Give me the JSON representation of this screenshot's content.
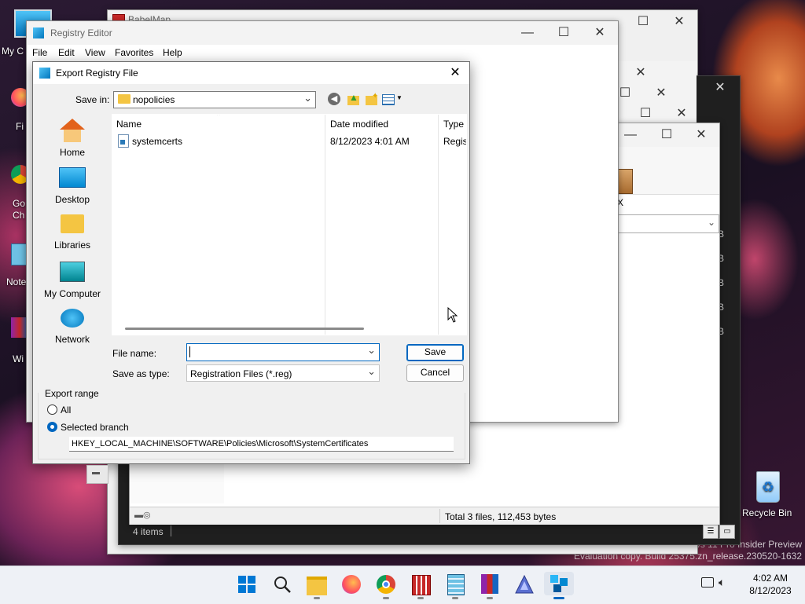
{
  "desktop": {
    "icons": [
      {
        "label": "My C"
      },
      {
        "label": "Fi"
      },
      {
        "label": "Go Ch"
      },
      {
        "label": "Note"
      },
      {
        "label": "Wi"
      },
      {
        "label": "Recycle Bin"
      }
    ],
    "watermark_line1": "ws 11 Pro Insider Preview",
    "watermark_line2": "Evaluation copy. Build 25375.zn_release.230520-1632"
  },
  "bg_windows": {
    "babelmap_title": "BabelMap",
    "file_manager": {
      "status_total": "Total 3 files, 112,453 bytes",
      "items_count": "4 items",
      "right_letters": [
        "B",
        "B",
        "B",
        "B",
        "B"
      ],
      "partial_icon_label": "X"
    }
  },
  "registry_editor": {
    "title": "Registry Editor",
    "menu": [
      "File",
      "Edit",
      "View",
      "Favorites",
      "Help"
    ]
  },
  "dialog": {
    "title": "Export Registry File",
    "save_in_label": "Save in:",
    "save_in_value": "nopolicies",
    "places": [
      "Home",
      "Desktop",
      "Libraries",
      "My Computer",
      "Network"
    ],
    "columns": [
      "Name",
      "Date modified",
      "Type"
    ],
    "files": [
      {
        "name": "systemcerts",
        "date": "8/12/2023 4:01 AM",
        "type": "Regis"
      }
    ],
    "file_name_label": "File name:",
    "file_name_value": "",
    "save_as_type_label": "Save as type:",
    "save_as_type_value": "Registration Files (*.reg)",
    "save_button": "Save",
    "cancel_button": "Cancel",
    "export_range_label": "Export range",
    "all_label": "All",
    "selected_branch_label": "Selected branch",
    "selected_branch_value": "HKEY_LOCAL_MACHINE\\SOFTWARE\\Policies\\Microsoft\\SystemCertificates"
  },
  "taskbar": {
    "time": "4:02 AM",
    "date": "8/12/2023",
    "apps": [
      "start-icon",
      "search-icon",
      "file-explorer-icon",
      "firefox-icon",
      "chrome-icon",
      "babelmap-icon",
      "notepad-icon",
      "winrar-icon",
      "app-icon",
      "registry-editor-icon"
    ]
  },
  "colors": {
    "accent": "#0067c0",
    "taskbar_bg": "#eef1f6"
  }
}
